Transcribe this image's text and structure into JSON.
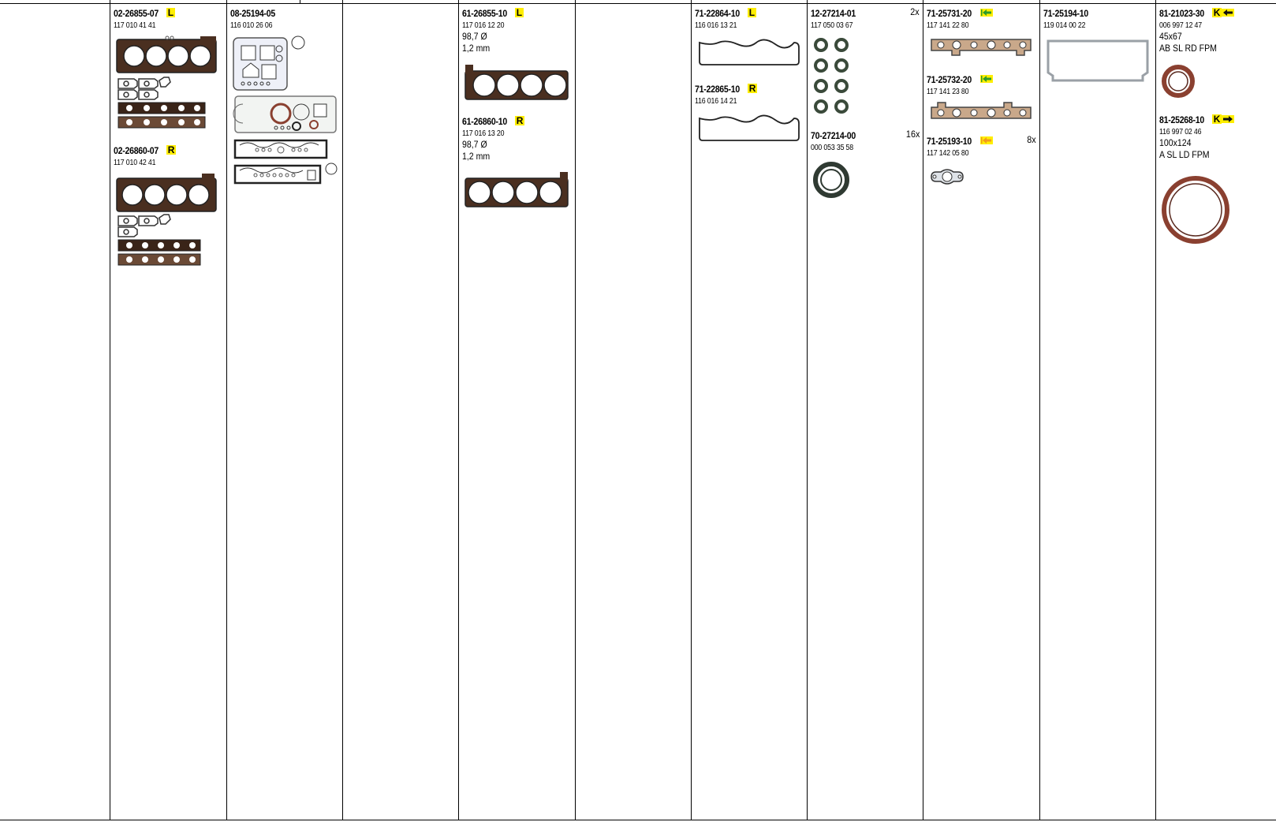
{
  "columns": [
    {
      "id": "c0",
      "entries": []
    },
    {
      "id": "c1",
      "entries": [
        {
          "part": "02-26855-07",
          "badge": "L",
          "oe": "117 010 41 41"
        },
        {
          "part": "02-26860-07",
          "badge": "R",
          "oe": "117 010 42 41"
        }
      ]
    },
    {
      "id": "c2",
      "entries": [
        {
          "part": "08-25194-05",
          "oe": "116 010 26 06"
        }
      ]
    },
    {
      "id": "c3",
      "entries": []
    },
    {
      "id": "c4",
      "entries": [
        {
          "part": "61-26855-10",
          "badge": "L",
          "oe": "117 016 12 20",
          "spec1": "98,7 Ø",
          "spec2": "1,2 mm"
        },
        {
          "part": "61-26860-10",
          "badge": "R",
          "oe": "117 016 13 20",
          "spec1": "98,7 Ø",
          "spec2": "1,2 mm"
        }
      ]
    },
    {
      "id": "c5",
      "entries": []
    },
    {
      "id": "c6",
      "entries": [
        {
          "part": "71-22864-10",
          "badge": "L",
          "oe": "116 016 13 21"
        },
        {
          "part": "71-22865-10",
          "badge": "R",
          "oe": "116 016 14 21"
        }
      ]
    },
    {
      "id": "c7",
      "entries": [
        {
          "part": "12-27214-01",
          "qty": "2x",
          "oe": "117 050 03 67"
        },
        {
          "part": "70-27214-00",
          "qty": "16x",
          "oe": "000 053 35 58"
        }
      ]
    },
    {
      "id": "c8",
      "entries": [
        {
          "part": "71-25731-20",
          "arrow": "green-left",
          "oe": "117 141 22 80"
        },
        {
          "part": "71-25732-20",
          "arrow": "green-left",
          "oe": "117 141 23 80"
        },
        {
          "part": "71-25193-10",
          "arrow": "orange-left",
          "qty": "8x",
          "oe": "117 142 05 80"
        }
      ]
    },
    {
      "id": "c9",
      "entries": [
        {
          "part": "71-25194-10",
          "oe": "119 014 00 22"
        }
      ]
    },
    {
      "id": "c10",
      "entries": [
        {
          "part": "81-21023-30",
          "kbadge": "K",
          "arrow": "black-left",
          "oe": "006 997 12 47",
          "spec1": "45x67",
          "spec2": "AB SL RD FPM"
        },
        {
          "part": "81-25268-10",
          "kbadge": "K",
          "arrow": "black-right",
          "oe": "116 997 02 46",
          "spec1": "100x124",
          "spec2": "A SL LD FPM"
        }
      ]
    }
  ],
  "colors": {
    "badge": "#ffee00",
    "green_arrow": "#2c9a2c",
    "orange_arrow": "#f29a1e",
    "gasket": "#5a3a2a",
    "seal": "#8a4030",
    "outline": "#333333"
  }
}
